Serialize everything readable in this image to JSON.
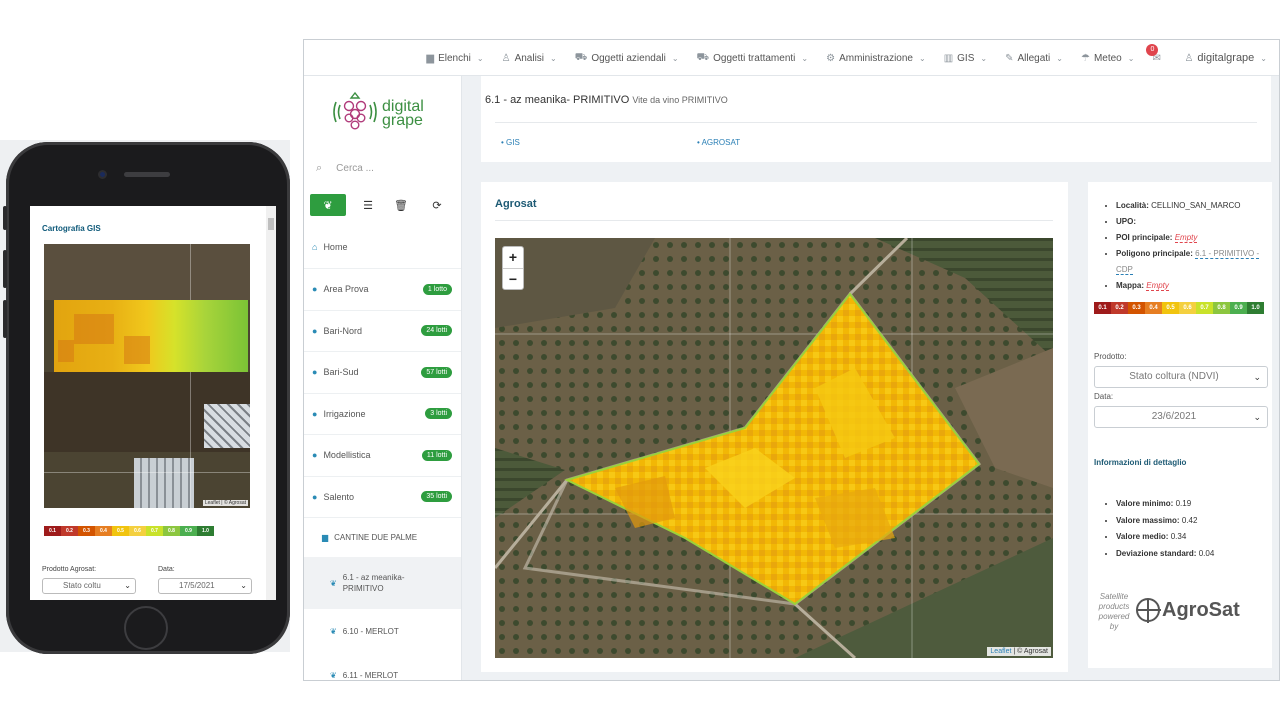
{
  "colors": {
    "accent_green": "#2e9d3f",
    "link_blue": "#2a7fb5",
    "title_teal": "#1d5a74",
    "alert_red": "#e0454d",
    "ndvi_scale": [
      "#9e1b1b",
      "#c0392b",
      "#d35400",
      "#e67e22",
      "#f1c40f",
      "#f4d03f",
      "#c9e22a",
      "#8cc63f",
      "#4caf50",
      "#2e7d32"
    ]
  },
  "mobile": {
    "title": "Cartografia GIS",
    "attribution": "Leaflet | © Agrosat",
    "scale": [
      "0.1",
      "0.2",
      "0.3",
      "0.4",
      "0.5",
      "0.6",
      "0.7",
      "0.8",
      "0.9",
      "1.0"
    ],
    "product_label": "Prodotto Agrosat:",
    "date_label": "Data:",
    "product_value": "Stato coltu",
    "date_value": "17/5/2021"
  },
  "topnav": {
    "items": [
      {
        "icon": "folder-icon",
        "label": "Elenchi"
      },
      {
        "icon": "user-icon",
        "label": "Analisi"
      },
      {
        "icon": "tractor-icon",
        "label": "Oggetti aziendali"
      },
      {
        "icon": "tractor-icon",
        "label": "Oggetti trattamenti"
      },
      {
        "icon": "gear-icon",
        "label": "Amministrazione"
      },
      {
        "icon": "map-icon",
        "label": "GIS"
      },
      {
        "icon": "paperclip-icon",
        "label": "Allegati"
      },
      {
        "icon": "umbrella-icon",
        "label": "Meteo"
      }
    ],
    "mail_badge": "0",
    "user": "digitalgrape"
  },
  "sidebar": {
    "logo_line1": "digital",
    "logo_line2": "grape",
    "search_placeholder": "Cerca ...",
    "home": "Home",
    "groups": [
      {
        "label": "Area Prova",
        "count": "1 lotto"
      },
      {
        "label": "Bari-Nord",
        "count": "24 lotti"
      },
      {
        "label": "Bari-Sud",
        "count": "57 lotti"
      },
      {
        "label": "Irrigazione",
        "count": "3 lotti"
      },
      {
        "label": "Modellistica",
        "count": "11 lotti"
      },
      {
        "label": "Salento",
        "count": "35 lotti"
      }
    ],
    "folder": "CANTINE DUE PALME",
    "plots": [
      {
        "label_line1": "6.1 - az meanika-",
        "label_line2": "PRIMITIVO"
      },
      {
        "label_line1": "6.10 - MERLOT",
        "label_line2": ""
      },
      {
        "label_line1": "6.11 - MERLOT",
        "label_line2": ""
      }
    ]
  },
  "header": {
    "title": "6.1 - az meanika- PRIMITIVO",
    "subtitle": "Vite da vino PRIMITIVO",
    "links": [
      "GIS",
      "AGROSAT"
    ]
  },
  "map_card": {
    "title": "Agrosat",
    "zoom_in": "+",
    "zoom_out": "−",
    "attribution_link": "Leaflet",
    "attribution_rest": "| © Agrosat"
  },
  "info": {
    "localita_label": "Località:",
    "localita_value": "CELLINO_SAN_MARCO",
    "upo_label": "UPO:",
    "poi_label": "POI principale:",
    "poi_value": "Empty",
    "poligono_label": "Poligono principale:",
    "poligono_value": "6.1 - PRIMITIVO - CDP",
    "mappa_label": "Mappa:",
    "mappa_value": "Empty",
    "scale": [
      "0.1",
      "0.2",
      "0.3",
      "0.4",
      "0.5",
      "0.6",
      "0.7",
      "0.8",
      "0.9",
      "1.0"
    ],
    "product_label": "Prodotto:",
    "product_value": "Stato coltura (NDVI)",
    "date_label": "Data:",
    "date_value": "23/6/2021",
    "detail_title": "Informazioni di dettaglio",
    "stats": [
      {
        "label": "Valore minimo:",
        "value": "0.19"
      },
      {
        "label": "Valore massimo:",
        "value": "0.42"
      },
      {
        "label": "Valore medio:",
        "value": "0.34"
      },
      {
        "label": "Deviazione standard:",
        "value": "0.04"
      }
    ],
    "powered_by": "Satellite products powered by",
    "brand": "AgroSat"
  }
}
